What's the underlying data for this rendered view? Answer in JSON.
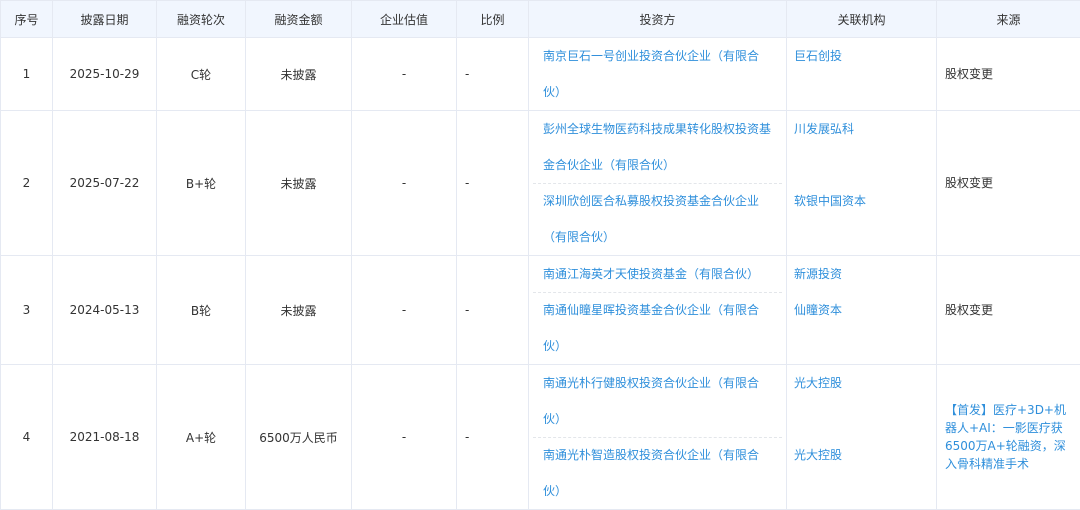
{
  "columns": [
    "序号",
    "披露日期",
    "融资轮次",
    "融资金额",
    "企业估值",
    "比例",
    "投资方",
    "关联机构",
    "来源"
  ],
  "rows": [
    {
      "no": "1",
      "date": "2025-10-29",
      "round": "C轮",
      "amount": "未披露",
      "valuation": "-",
      "ratio": "-",
      "investors": [
        {
          "lines": [
            "南京巨石一号创业投资合伙企业（有限合",
            "伙）"
          ],
          "org": "巨石创投"
        }
      ],
      "source": "股权变更"
    },
    {
      "no": "2",
      "date": "2025-07-22",
      "round": "B+轮",
      "amount": "未披露",
      "valuation": "-",
      "ratio": "-",
      "investors": [
        {
          "lines": [
            "彭州全球生物医药科技成果转化股权投资基",
            "金合伙企业（有限合伙）"
          ],
          "org": "川发展弘科"
        },
        {
          "lines": [
            "深圳欣创医合私募股权投资基金合伙企业",
            "（有限合伙）"
          ],
          "org": "软银中国资本"
        }
      ],
      "source": "股权变更"
    },
    {
      "no": "3",
      "date": "2024-05-13",
      "round": "B轮",
      "amount": "未披露",
      "valuation": "-",
      "ratio": "-",
      "investors": [
        {
          "lines": [
            "南通江海英才天使投资基金（有限合伙）"
          ],
          "org": "新源投资"
        },
        {
          "lines": [
            "南通仙瞳星晖投资基金合伙企业（有限合",
            "伙）"
          ],
          "org": "仙瞳资本"
        }
      ],
      "source": "股权变更"
    },
    {
      "no": "4",
      "date": "2021-08-18",
      "round": "A+轮",
      "amount": "6500万人民币",
      "valuation": "-",
      "ratio": "-",
      "investors": [
        {
          "lines": [
            "南通光朴行健股权投资合伙企业（有限合",
            "伙）"
          ],
          "org": "光大控股"
        },
        {
          "lines": [
            "南通光朴智造股权投资合伙企业（有限合",
            "伙）"
          ],
          "org": "光大控股"
        }
      ],
      "source_link": "【首发】医疗+3D+机器人+AI：一影医疗获6500万A+轮融资，深入骨科精准手术"
    }
  ]
}
